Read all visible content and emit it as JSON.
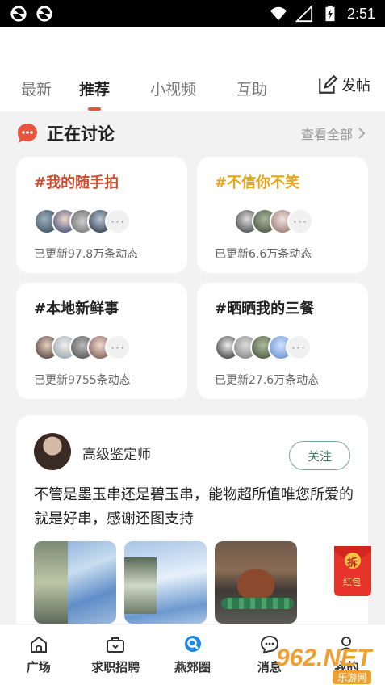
{
  "status_bar": {
    "time": "2:51",
    "icons": [
      "sync-icon",
      "sync-icon",
      "wifi-icon",
      "signal-icon",
      "battery-charging-icon"
    ]
  },
  "tabs": [
    {
      "label": "最新",
      "active": false
    },
    {
      "label": "推荐",
      "active": true
    },
    {
      "label": "小视频",
      "active": false
    },
    {
      "label": "互助",
      "active": false
    }
  ],
  "post_button": {
    "label": "发帖",
    "icon": "edit-icon"
  },
  "discussion": {
    "icon": "chat-bubble-icon",
    "title": "正在讨论",
    "view_all": "查看全部"
  },
  "topics": [
    {
      "title": "#我的随手拍",
      "count": "已更新97.8万条动态",
      "color": "#d14b2e"
    },
    {
      "title": "#不信你不笑",
      "count": "已更新6.6万条动态",
      "color": "#e8a317"
    },
    {
      "title": "#本地新鲜事",
      "count": "已更新9755条动态",
      "color": "#222222"
    },
    {
      "title": "#晒晒我的三餐",
      "count": "已更新27.6万条动态",
      "color": "#222222"
    }
  ],
  "post": {
    "user_name": "高级鉴定师",
    "follow_label": "关注",
    "text": "不管是墨玉串还是碧玉串，能物超所值唯您所爱的就是好串，感谢还图支持"
  },
  "bottom_nav": [
    {
      "label": "广场",
      "icon": "home-icon",
      "active": false
    },
    {
      "label": "求职招聘",
      "icon": "briefcase-icon",
      "active": false
    },
    {
      "label": "燕郊圈",
      "icon": "circle-search-icon",
      "active": true
    },
    {
      "label": "消息",
      "icon": "message-icon",
      "active": false
    },
    {
      "label": "我的",
      "icon": "user-icon",
      "active": false
    }
  ],
  "red_packet": {
    "top_text": "拆",
    "bottom_text": "红包"
  },
  "watermark": {
    "main": "962.NET",
    "sub": "乐游网"
  },
  "colors": {
    "accent": "#e8553e",
    "follow_green": "#3f7a62",
    "nav_blue": "#1e88e5"
  }
}
